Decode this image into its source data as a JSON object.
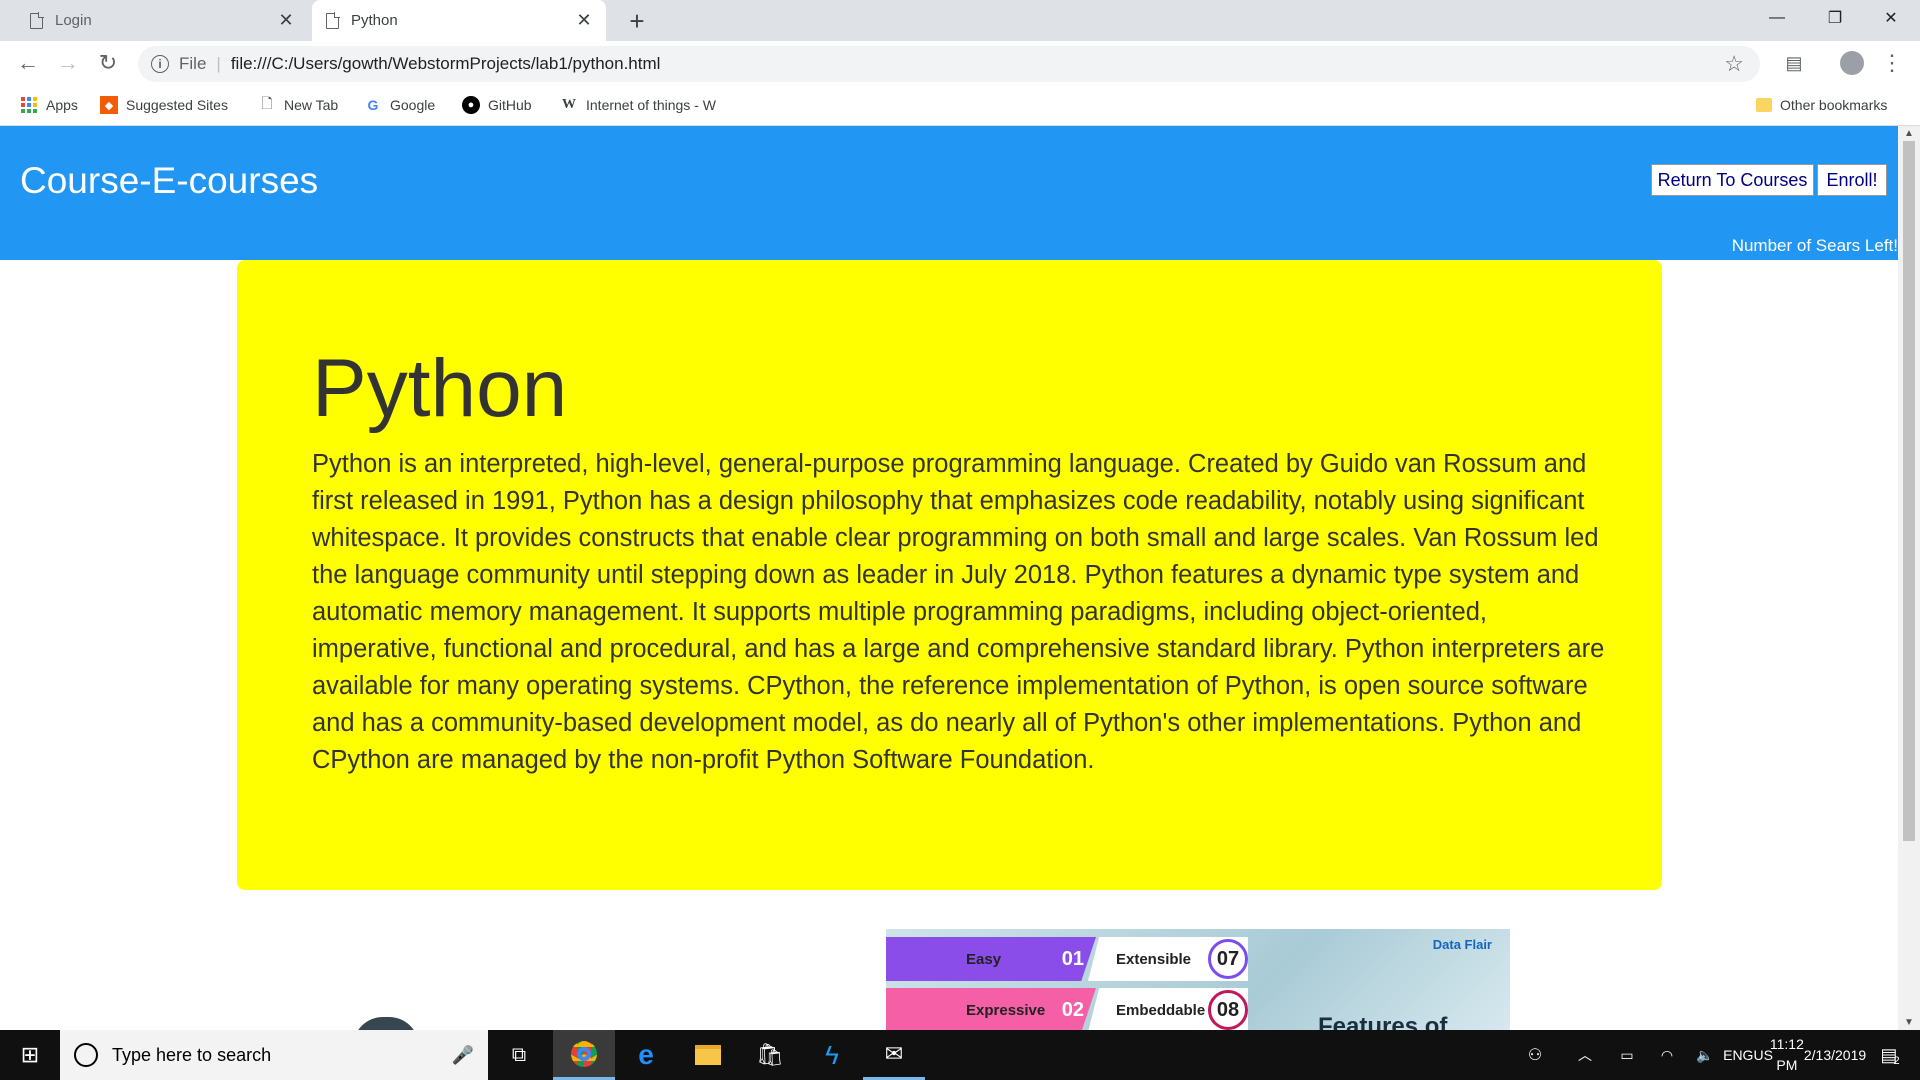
{
  "browser": {
    "tabs": [
      {
        "title": "Login",
        "active": false
      },
      {
        "title": "Python",
        "active": true
      }
    ],
    "address": {
      "scheme_label": "File",
      "url": "file:///C:/Users/gowth/WebstormProjects/lab1/python.html"
    },
    "bookmarks": [
      {
        "label": "Apps"
      },
      {
        "label": "Suggested Sites"
      },
      {
        "label": "New Tab"
      },
      {
        "label": "Google"
      },
      {
        "label": "GitHub"
      },
      {
        "label": "Internet of things - W"
      }
    ],
    "other_bookmarks": "Other bookmarks"
  },
  "site": {
    "title": "Course-E-courses",
    "return_button": "Return To Courses",
    "enroll_button": "Enroll!",
    "seats_label": "Number of Sears Left!"
  },
  "course": {
    "heading": "Python",
    "description": "Python is an interpreted, high-level, general-purpose programming language. Created by Guido van Rossum and first released in 1991, Python has a design philosophy that emphasizes code readability, notably using significant whitespace. It provides constructs that enable clear programming on both small and large scales. Van Rossum led the language community until stepping down as leader in July 2018. Python features a dynamic type system and automatic memory management. It supports multiple programming paradigms, including object-oriented, imperative, functional and procedural, and has a large and comprehensive standard library. Python interpreters are available for many operating systems. CPython, the reference implementation of Python, is open source software and has a community-based development model, as do nearly all of Python's other implementations. Python and CPython are managed by the non-profit Python Software Foundation."
  },
  "infographic": {
    "rows": [
      {
        "left_label": "Easy",
        "left_num": "01",
        "right_label": "Extensible",
        "right_num": "07",
        "left_color": "#8b4dea"
      },
      {
        "left_label": "Expressive",
        "left_num": "02",
        "right_label": "Embeddable",
        "right_num": "08",
        "left_color": "#f45fa6"
      }
    ],
    "heading": "Features of",
    "logo_text": "Data Flair"
  },
  "taskbar": {
    "search_placeholder": "Type here to search",
    "lang_top": "ENG",
    "lang_bottom": "US",
    "time": "11:12 PM",
    "date": "2/13/2019",
    "notification_count": "2"
  },
  "colors": {
    "header": "#2196f3",
    "card": "#ffff00",
    "button_text": "#000080"
  }
}
